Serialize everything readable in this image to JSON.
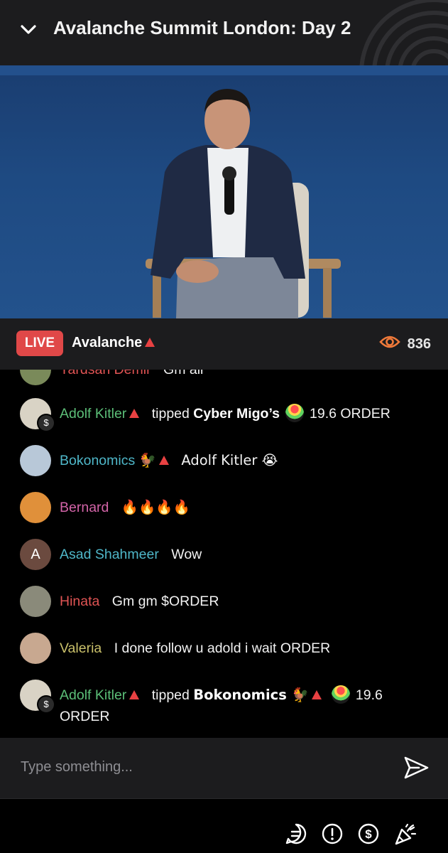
{
  "header": {
    "title": "Avalanche Summit London: Day 2"
  },
  "live": {
    "badge": "LIVE",
    "channel": "Avalanche",
    "viewers": "836"
  },
  "chat": {
    "partial": {
      "user": "Yardsan Demir",
      "text": "Gm all"
    },
    "messages": [
      {
        "user": "Adolf Kitler",
        "user_color": "#5cbf78",
        "avatar_color": "#d9d3c5",
        "tip": true,
        "action": "tipped",
        "target": "Cyber Migo’s",
        "amount": "19.6 ORDER"
      },
      {
        "user": "Bokonomics",
        "user_color": "#4fb7c9",
        "avatar_color": "#b8c8d8",
        "suffix": "🐓",
        "text": "Adolf Kitler 😭"
      },
      {
        "user": "Bernard",
        "user_color": "#d364a8",
        "avatar_color": "#e0903a",
        "text": "🔥🔥🔥🔥"
      },
      {
        "user": "Asad Shahmeer",
        "user_color": "#4fb7c9",
        "avatar_color": "#6b4a3f",
        "avatar_letter": "A",
        "text": "Wow"
      },
      {
        "user": "Hinata",
        "user_color": "#e05454",
        "avatar_color": "#8a8a7a",
        "text": "Gm gm $ORDER"
      },
      {
        "user": "Valeria",
        "user_color": "#c9c06a",
        "avatar_color": "#c8a890",
        "text": "I done follow u adold i wait ORDER"
      },
      {
        "user": "Adolf Kitler",
        "user_color": "#5cbf78",
        "avatar_color": "#d9d3c5",
        "tip": true,
        "action": "tipped",
        "target": "Bokonomics 🐓",
        "amount": "19.6 ORDER"
      }
    ]
  },
  "input": {
    "placeholder": "Type something..."
  },
  "colors": {
    "accent_live": "#e04848",
    "avalanche": "#e84142",
    "viewer_icon": "#f07a3a",
    "surface": "#1c1c1e"
  },
  "icons": [
    "chevron-down-icon",
    "eye-icon",
    "send-icon",
    "chat-icon",
    "alert-icon",
    "dollar-icon",
    "party-icon"
  ]
}
